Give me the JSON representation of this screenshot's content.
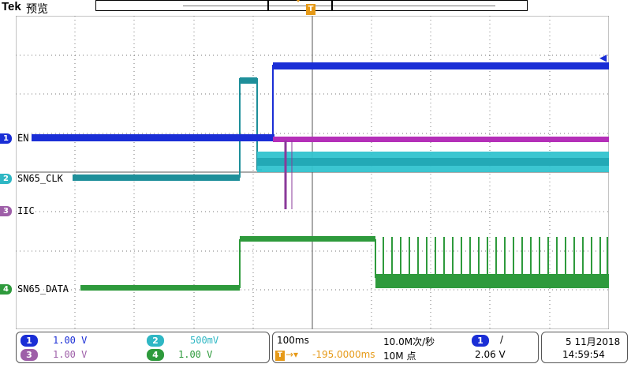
{
  "header": {
    "brand": "Tek",
    "mode": "预览"
  },
  "markers": {
    "trigger_symbol": "T"
  },
  "channels": [
    {
      "id": "1",
      "label": "EN",
      "color": "#1a2ed6"
    },
    {
      "id": "2",
      "label": "SN65_CLK",
      "color": "#2fb7c4"
    },
    {
      "id": "3",
      "label": "IIC",
      "color": "#9e5fa8"
    },
    {
      "id": "4",
      "label": "SN65_DATA",
      "color": "#2e9a3c"
    }
  ],
  "scales": {
    "ch1": {
      "id": "1",
      "value": "1.00 V"
    },
    "ch2": {
      "id": "2",
      "value": "500mV"
    },
    "ch3": {
      "id": "3",
      "value": "1.00 V"
    },
    "ch4": {
      "id": "4",
      "value": "1.00 V"
    }
  },
  "timebase": {
    "per_div": "100ms",
    "sample_rate": "10.0M次/秒",
    "trigger_position": "-195.0000ms",
    "record_length": "10M 点",
    "trigger_source": "1",
    "trigger_slope": "/",
    "trigger_level": "2.06 V"
  },
  "datetime": {
    "date": "5 11月2018",
    "time": "14:59:54"
  }
}
